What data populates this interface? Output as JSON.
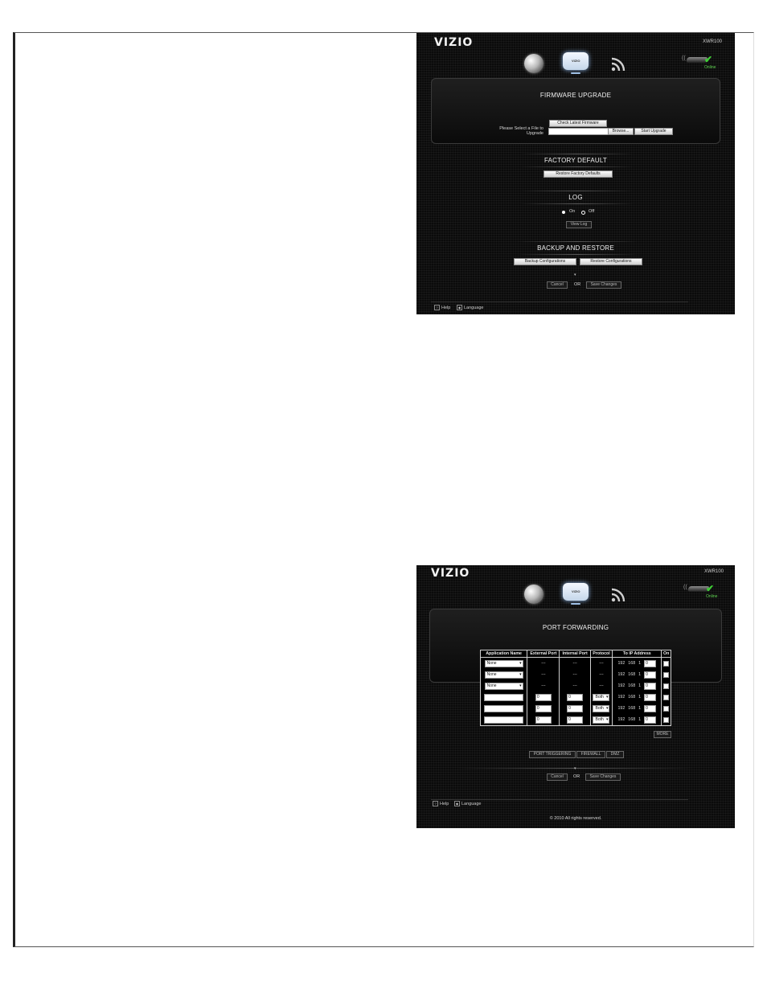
{
  "screen1": {
    "logo": "VIZIO",
    "model": "XWR100",
    "status_label": "Online",
    "router_icon_label": "VIZIO",
    "firmware": {
      "title": "FIRMWARE UPGRADE",
      "check_button": "Check Latest Firmware",
      "select_label": "Please Select a File to Upgrade",
      "file_value": "",
      "browse_button": "Browse...",
      "start_button": "Start Upgrade"
    },
    "factory": {
      "title": "FACTORY DEFAULT",
      "restore_button": "Restore Factory Defaults"
    },
    "log": {
      "title": "LOG",
      "on_label": "On",
      "off_label": "Off",
      "selected": "On",
      "view_button": "View Log"
    },
    "backup": {
      "title": "BACKUP AND RESTORE",
      "backup_button": "Backup Configurations",
      "restore_button": "Restore Configurations"
    },
    "actions": {
      "cancel": "Cancel",
      "or": "OR",
      "save": "Save Changes"
    },
    "footer": {
      "help": "Help",
      "language": "Language"
    }
  },
  "screen2": {
    "logo": "VIZIO",
    "model": "XWR100",
    "status_label": "Online",
    "router_icon_label": "VIZIO",
    "title": "PORT FORWARDING",
    "table": {
      "headers": [
        "Application Name",
        "External Port",
        "Internal Port",
        "Protocol",
        "To IP Address",
        "On"
      ],
      "preset_rows": [
        {
          "app": "None",
          "ext": "---",
          "int": "---",
          "proto": "---",
          "ip": [
            "192",
            "168",
            "1"
          ],
          "last_octet": "0"
        },
        {
          "app": "None",
          "ext": "---",
          "int": "---",
          "proto": "---",
          "ip": [
            "192",
            "168",
            "1"
          ],
          "last_octet": "0"
        },
        {
          "app": "None",
          "ext": "---",
          "int": "---",
          "proto": "---",
          "ip": [
            "192",
            "168",
            "1"
          ],
          "last_octet": "0"
        }
      ],
      "custom_rows": [
        {
          "app": "",
          "ext": "0",
          "int": "0",
          "proto": "Both",
          "ip": [
            "192",
            "168",
            "1"
          ],
          "last_octet": "0"
        },
        {
          "app": "",
          "ext": "0",
          "int": "0",
          "proto": "Both",
          "ip": [
            "192",
            "168",
            "1"
          ],
          "last_octet": "0"
        },
        {
          "app": "",
          "ext": "0",
          "int": "0",
          "proto": "Both",
          "ip": [
            "192",
            "168",
            "1"
          ],
          "last_octet": "0"
        }
      ]
    },
    "more_button": "MORE",
    "tabs": [
      "PORT TRIGGERING",
      "FIREWALL",
      "DMZ"
    ],
    "actions": {
      "cancel": "Cancel",
      "or": "OR",
      "save": "Save Changes"
    },
    "footer": {
      "help": "Help",
      "language": "Language",
      "copyright": "© 2010  All rights reserved."
    }
  },
  "colors": {
    "screen_bg": "#0b0b0b",
    "online_green": "#3fcf36",
    "router_glow": "#8fb6e8"
  }
}
